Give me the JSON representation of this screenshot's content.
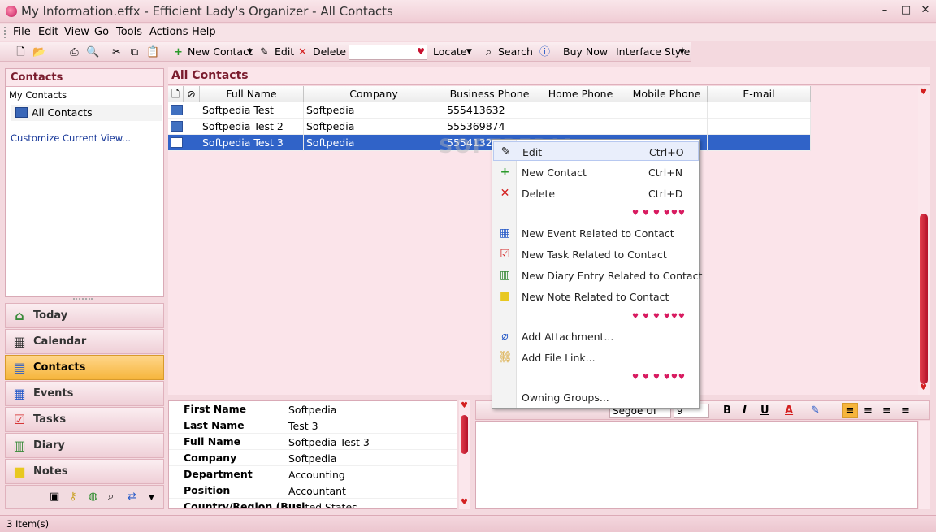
{
  "window": {
    "title": "My Information.effx - Efficient Lady's Organizer - All Contacts",
    "minimize": "–",
    "maximize": "□",
    "close": "✕"
  },
  "menu": [
    "File",
    "Edit",
    "View",
    "Go",
    "Tools",
    "Actions",
    "Help"
  ],
  "toolbar": {
    "new_contact": "New Contact",
    "edit": "Edit",
    "delete": "Delete",
    "locate": "Locate",
    "search": "Search",
    "buy_now": "Buy Now",
    "interface_style": "Interface Style"
  },
  "left_panel": {
    "title": "Contacts",
    "subtitle": "My Contacts",
    "item": "All Contacts",
    "link": "Customize Current View..."
  },
  "nav": [
    "Today",
    "Calendar",
    "Contacts",
    "Events",
    "Tasks",
    "Diary",
    "Notes"
  ],
  "nav_active": "Contacts",
  "main": {
    "header": "All Contacts",
    "columns": [
      "Full Name",
      "Company",
      "Business Phone",
      "Home Phone",
      "Mobile Phone",
      "E-mail"
    ],
    "rows": [
      {
        "full_name": "Softpedia Test",
        "company": "Softpedia",
        "business_phone": "555413632",
        "home_phone": "",
        "mobile_phone": "",
        "email": ""
      },
      {
        "full_name": "Softpedia Test 2",
        "company": "Softpedia",
        "business_phone": "555369874",
        "home_phone": "",
        "mobile_phone": "",
        "email": ""
      },
      {
        "full_name": "Softpedia Test 3",
        "company": "Softpedia",
        "business_phone": "555413269",
        "home_phone": "",
        "mobile_phone": "",
        "email": ""
      }
    ],
    "selected_row": 2
  },
  "details": [
    {
      "label": "First Name",
      "value": "Softpedia"
    },
    {
      "label": "Last Name",
      "value": "Test 3"
    },
    {
      "label": "Full Name",
      "value": "Softpedia Test 3"
    },
    {
      "label": "Company",
      "value": "Softpedia"
    },
    {
      "label": "Department",
      "value": "Accounting"
    },
    {
      "label": "Position",
      "value": "Accountant"
    },
    {
      "label": "Country/Region (Busi",
      "value": "United States"
    }
  ],
  "notes_toolbar": {
    "font": "Segoe UI",
    "size": "9",
    "bold": "B",
    "italic": "I",
    "underline": "U",
    "font_color": "A"
  },
  "context_menu": {
    "items": [
      {
        "label": "Edit",
        "shortcut": "Ctrl+O"
      },
      {
        "label": "New Contact",
        "shortcut": "Ctrl+N"
      },
      {
        "label": "Delete",
        "shortcut": "Ctrl+D"
      },
      {
        "label": "New Event Related to Contact",
        "shortcut": ""
      },
      {
        "label": "New Task Related to Contact",
        "shortcut": ""
      },
      {
        "label": "New Diary Entry Related to Contact",
        "shortcut": ""
      },
      {
        "label": "New Note Related to Contact",
        "shortcut": ""
      },
      {
        "label": "Add Attachment...",
        "shortcut": ""
      },
      {
        "label": "Add File Link...",
        "shortcut": ""
      },
      {
        "label": "Owning Groups...",
        "shortcut": ""
      }
    ]
  },
  "status": "3 Item(s)",
  "colors": {
    "accent": "#7a1c2e",
    "selection": "#3063c8",
    "nav_active": "#f6b53c",
    "background": "#f4d9df"
  }
}
